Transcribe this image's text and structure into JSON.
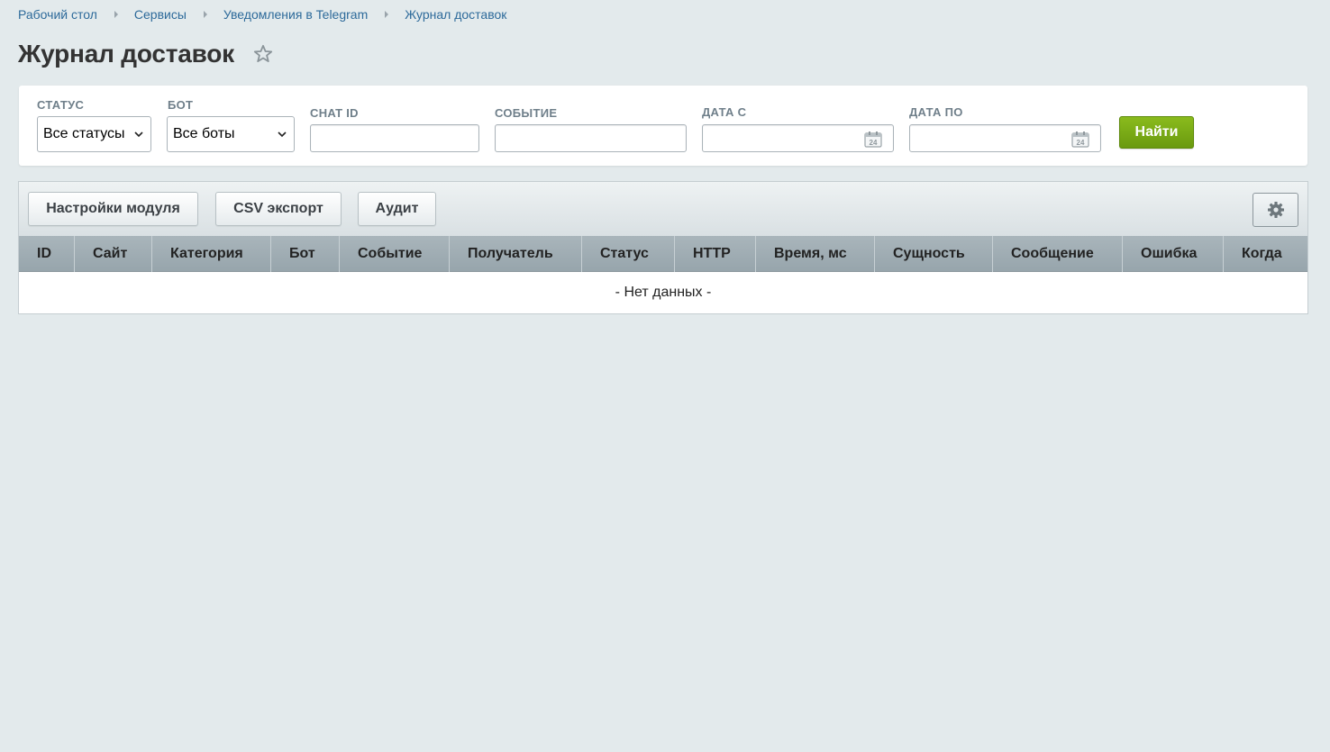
{
  "breadcrumb": {
    "items": [
      "Рабочий стол",
      "Сервисы",
      "Уведомления в Telegram",
      "Журнал доставок"
    ]
  },
  "page": {
    "title": "Журнал доставок"
  },
  "filters": {
    "status": {
      "label": "СТАТУС",
      "value": "Все статусы"
    },
    "bot": {
      "label": "БОТ",
      "value": "Все боты"
    },
    "chat_id": {
      "label": "CHAT ID",
      "value": ""
    },
    "event": {
      "label": "СОБЫТИЕ",
      "value": ""
    },
    "date_from": {
      "label": "ДАТА С",
      "value": ""
    },
    "date_to": {
      "label": "ДАТА ПО",
      "value": ""
    },
    "find_label": "Найти",
    "calendar_day": "24"
  },
  "toolbar": {
    "settings_label": "Настройки модуля",
    "csv_label": "CSV экспорт",
    "audit_label": "Аудит"
  },
  "table": {
    "columns": [
      "ID",
      "Сайт",
      "Категория",
      "Бот",
      "Событие",
      "Получатель",
      "Статус",
      "HTTP",
      "Время, мс",
      "Сущность",
      "Сообщение",
      "Ошибка",
      "Когда"
    ],
    "empty_text": "- Нет данных -"
  },
  "colors": {
    "page_bg": "#e3eaec",
    "link": "#2d6a9a",
    "accent_green": "#7aab16",
    "header_gray": "#a0adb3"
  },
  "icons": {
    "favorite": "star-icon",
    "calendar": "calendar-icon",
    "select_arrow": "chevron-down-icon",
    "grid_settings": "gear-icon"
  }
}
